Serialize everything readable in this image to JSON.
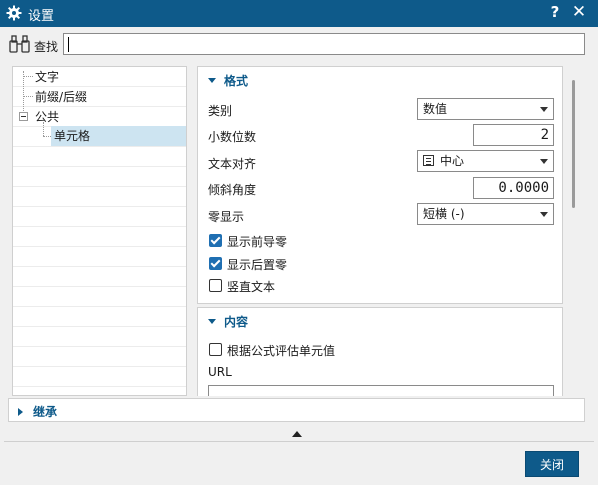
{
  "window": {
    "title": "设置"
  },
  "search": {
    "label": "查找",
    "value": ""
  },
  "tree": {
    "items": [
      {
        "label": "文字"
      },
      {
        "label": "前缀/后缀"
      },
      {
        "label": "公共"
      },
      {
        "label": "单元格",
        "selected": true
      }
    ]
  },
  "format": {
    "header": "格式",
    "category": {
      "label": "类别",
      "value": "数值"
    },
    "decimals": {
      "label": "小数位数",
      "value": "2"
    },
    "align": {
      "label": "文本对齐",
      "value": "中心",
      "icon": "align-center-icon"
    },
    "slant": {
      "label": "倾斜角度",
      "value": "0.0000"
    },
    "zero": {
      "label": "零显示",
      "value": "短横 (-)"
    },
    "checks": [
      {
        "label": "显示前导零",
        "checked": true
      },
      {
        "label": "显示后置零",
        "checked": true
      },
      {
        "label": "竖直文本",
        "checked": false
      }
    ]
  },
  "content": {
    "header": "内容",
    "evaluate": {
      "label": "根据公式评估单元值",
      "checked": false
    },
    "url": {
      "label": "URL",
      "value": ""
    }
  },
  "inherit": {
    "header": "继承"
  },
  "footer": {
    "close_label": "关闭"
  },
  "colors": {
    "accent": "#0e5a8a",
    "selection": "#cde4f1",
    "checkbox": "#1f6fb2"
  }
}
